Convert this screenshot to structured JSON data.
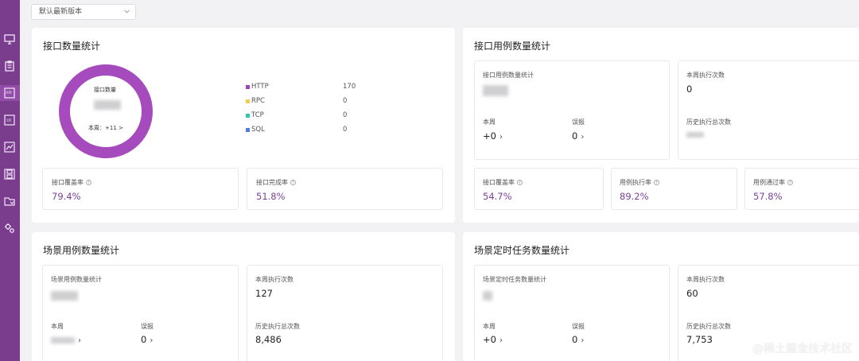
{
  "version_select": {
    "value": "默认最新版本"
  },
  "sidebar": {
    "icons": [
      "monitor-icon",
      "clipboard-icon",
      "api-icon",
      "ui-icon",
      "chart-icon",
      "save-icon",
      "folder-icon",
      "settings-icon"
    ]
  },
  "api_stats": {
    "title": "接口数量统计",
    "donut": {
      "label": "接口数量",
      "week": "本周：+11 >",
      "color": "#a54bbd"
    },
    "legend": [
      {
        "name": "HTTP",
        "value": "170",
        "color": "#9b45b8"
      },
      {
        "name": "RPC",
        "value": "0",
        "color": "#f1cf4a"
      },
      {
        "name": "TCP",
        "value": "0",
        "color": "#2fc7a9"
      },
      {
        "name": "SQL",
        "value": "0",
        "color": "#4e7de2"
      }
    ],
    "coverage": {
      "label": "接口覆盖率",
      "value": "79.4%"
    },
    "completion": {
      "label": "接口完成率",
      "value": "51.8%"
    }
  },
  "case_stats": {
    "title": "接口用例数量统计",
    "count_label": "接口用例数量统计",
    "week_label": "本周",
    "week_value": "+0",
    "false_label": "误报",
    "false_value": "0",
    "exec_week_label": "本周执行次数",
    "exec_week_value": "0",
    "exec_total_label": "历史执行总次数",
    "coverage": {
      "label": "接口覆盖率",
      "value": "54.7%"
    },
    "exec_rate": {
      "label": "用例执行率",
      "value": "89.2%"
    },
    "pass_rate": {
      "label": "用例通过率",
      "value": "57.8%"
    }
  },
  "scene_stats": {
    "title": "场景用例数量统计",
    "count_label": "场景用例数量统计",
    "week_label": "本周",
    "false_label": "误报",
    "false_value": "0",
    "exec_week_label": "本周执行次数",
    "exec_week_value": "127",
    "exec_total_label": "历史执行总次数",
    "exec_total_value": "8,486"
  },
  "task_stats": {
    "title": "场景定时任务数量统计",
    "count_label": "场景定时任务数量统计",
    "week_label": "本周",
    "week_value": "+0",
    "false_label": "误报",
    "false_value": "0",
    "exec_week_label": "本周执行次数",
    "exec_week_value": "60",
    "exec_total_label": "历史执行总次数",
    "exec_total_value": "7,753"
  },
  "watermark": "@稀土掘金技术社区"
}
